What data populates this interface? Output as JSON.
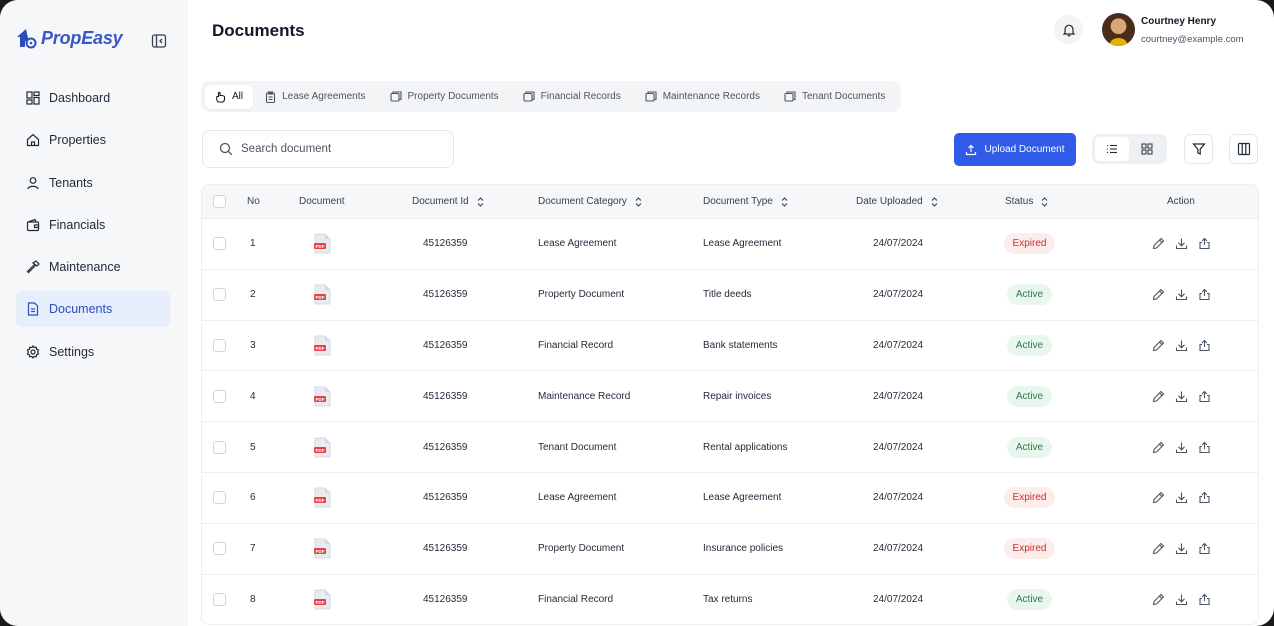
{
  "brand": {
    "name": "PropEasy",
    "color": "#3a56c4"
  },
  "sidebar": {
    "items": [
      {
        "label": "Dashboard",
        "icon": "grid-icon",
        "active": false
      },
      {
        "label": "Properties",
        "icon": "home-icon",
        "active": false
      },
      {
        "label": "Tenants",
        "icon": "user-icon",
        "active": false
      },
      {
        "label": "Financials",
        "icon": "wallet-icon",
        "active": false
      },
      {
        "label": "Maintenance",
        "icon": "hammer-icon",
        "active": false
      },
      {
        "label": "Documents",
        "icon": "document-icon",
        "active": true
      },
      {
        "label": "Settings",
        "icon": "gear-icon",
        "active": false
      }
    ]
  },
  "header": {
    "title": "Documents",
    "user": {
      "name": "Courtney Henry",
      "email": "courtney@example.com"
    }
  },
  "tabs": [
    {
      "label": "All",
      "active": true
    },
    {
      "label": "Lease Agreements",
      "active": false
    },
    {
      "label": "Property Documents",
      "active": false
    },
    {
      "label": "Financial Records",
      "active": false
    },
    {
      "label": "Maintenance Records",
      "active": false
    },
    {
      "label": "Tenant Documents",
      "active": false
    }
  ],
  "search": {
    "placeholder": "Search document",
    "value": ""
  },
  "toolbar": {
    "upload_label": "Upload Document",
    "view_mode": "list"
  },
  "table": {
    "columns": [
      "No",
      "Document",
      "Document Id",
      "Document Category",
      "Document Type",
      "Date Uploaded",
      "Status",
      "Action"
    ],
    "file_badge": "PDF",
    "rows": [
      {
        "no": "1",
        "id": "45126359",
        "category": "Lease Agreement",
        "type": "Lease Agreement",
        "date": "24/07/2024",
        "status": "Expired"
      },
      {
        "no": "2",
        "id": "45126359",
        "category": "Property Document",
        "type": "Title deeds",
        "date": "24/07/2024",
        "status": "Active"
      },
      {
        "no": "3",
        "id": "45126359",
        "category": "Financial Record",
        "type": "Bank statements",
        "date": "24/07/2024",
        "status": "Active"
      },
      {
        "no": "4",
        "id": "45126359",
        "category": "Maintenance Record",
        "type": "Repair invoices",
        "date": "24/07/2024",
        "status": "Active"
      },
      {
        "no": "5",
        "id": "45126359",
        "category": "Tenant Document",
        "type": "Rental applications",
        "date": "24/07/2024",
        "status": "Active"
      },
      {
        "no": "6",
        "id": "45126359",
        "category": "Lease Agreement",
        "type": "Lease Agreement",
        "date": "24/07/2024",
        "status": "Expired"
      },
      {
        "no": "7",
        "id": "45126359",
        "category": "Property Document",
        "type": "Insurance policies",
        "date": "24/07/2024",
        "status": "Expired"
      },
      {
        "no": "8",
        "id": "45126359",
        "category": "Financial Record",
        "type": "Tax returns",
        "date": "24/07/2024",
        "status": "Active"
      }
    ]
  },
  "colors": {
    "primary": "#2f5be8",
    "expired": "#c0352f",
    "active": "#2b7a4a"
  }
}
